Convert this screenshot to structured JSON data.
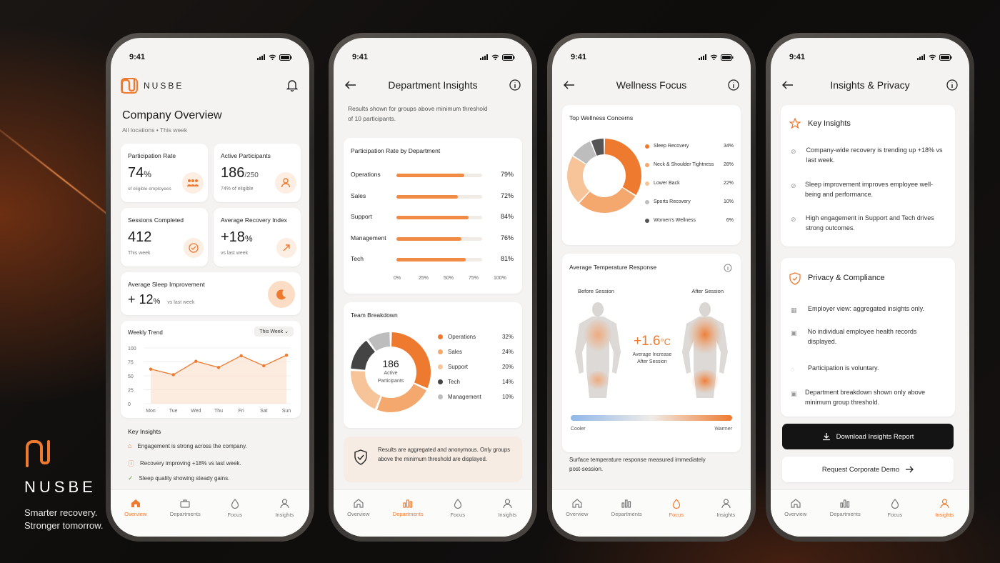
{
  "brand": {
    "name": "NUSBE",
    "tagline1": "Smarter recovery.",
    "tagline2": "Stronger tomorrow."
  },
  "status_time": "9:41",
  "tabs": [
    "Overview",
    "Departments",
    "Focus",
    "Insights"
  ],
  "overview": {
    "logo": "NUSBE",
    "title": "Company Overview",
    "subtitle": "All locations • This week",
    "cards": [
      {
        "label": "Participation Rate",
        "value": "74",
        "unit": "%",
        "sub": "of eligible employees",
        "icon": "people-icon"
      },
      {
        "label": "Active Participants",
        "value": "186",
        "unit": "/250",
        "sub": "74% of eligible",
        "icon": "person-icon"
      },
      {
        "label": "Sessions Completed",
        "value": "412",
        "unit": "",
        "sub": "This week",
        "icon": "check-icon"
      },
      {
        "label": "Average Recovery Index",
        "value": "+18",
        "unit": "%",
        "sub": "vs last week",
        "icon": "trend-icon"
      }
    ],
    "sleep": {
      "label": "Average Sleep Improvement",
      "value": "+ 12",
      "unit": "%",
      "sub": "vs last week"
    },
    "trend": {
      "title": "Weekly Trend",
      "filter": "This Week",
      "yticks": [
        "100",
        "75",
        "50",
        "25",
        "0"
      ],
      "days": [
        "Mon",
        "Tue",
        "Wed",
        "Thu",
        "Fri",
        "Sat",
        "Sun"
      ],
      "values": [
        62,
        52,
        76,
        65,
        86,
        68,
        87
      ]
    },
    "insights_title": "Key Insights",
    "insights": [
      "Engagement is strong across the company.",
      "Recovery improving +18% vs last week.",
      "Sleep quality showing steady gains."
    ]
  },
  "dept": {
    "title": "Department Insights",
    "note": "Results shown for groups above minimum threshold of 10 participants.",
    "bars_title": "Participation Rate by Department",
    "bars": [
      {
        "name": "Operations",
        "value": 79,
        "label": "79%"
      },
      {
        "name": "Sales",
        "value": 72,
        "label": "72%"
      },
      {
        "name": "Support",
        "value": 84,
        "label": "84%"
      },
      {
        "name": "Management",
        "value": 76,
        "label": "76%"
      },
      {
        "name": "Tech",
        "value": 81,
        "label": "81%"
      }
    ],
    "axis": [
      "0%",
      "25%",
      "50%",
      "75%",
      "100%"
    ],
    "team_title": "Team Breakdown",
    "center_value": "186",
    "center_label1": "Active",
    "center_label2": "Participants",
    "team": [
      {
        "name": "Operations",
        "value": 32,
        "label": "32%",
        "color": "#ee7a30"
      },
      {
        "name": "Sales",
        "value": 24,
        "label": "24%",
        "color": "#f4a86e"
      },
      {
        "name": "Support",
        "value": 20,
        "label": "20%",
        "color": "#f7c49a"
      },
      {
        "name": "Tech",
        "value": 14,
        "label": "14%",
        "color": "#444444"
      },
      {
        "name": "Management",
        "value": 10,
        "label": "10%",
        "color": "#bdbdbd"
      }
    ],
    "privacy_note": "Results are aggregated and anonymous. Only groups above the minimum threshold are displayed."
  },
  "focus": {
    "title": "Wellness Focus",
    "concerns_title": "Top Wellness Concerns",
    "concerns": [
      {
        "name": "Sleep Recovery",
        "value": 34,
        "label": "34%",
        "color": "#ee7a30"
      },
      {
        "name": "Neck & Shoulder Tightness",
        "value": 28,
        "label": "28%",
        "color": "#f4a86e"
      },
      {
        "name": "Lower Back",
        "value": 22,
        "label": "22%",
        "color": "#f7c49a"
      },
      {
        "name": "Sports Recovery",
        "value": 10,
        "label": "10%",
        "color": "#bdbdbd"
      },
      {
        "name": "Women's Wellness",
        "value": 6,
        "label": "6%",
        "color": "#555555"
      }
    ],
    "temp_title": "Average Temperature Response",
    "before": "Before Session",
    "after": "After Session",
    "delta": "+1.6",
    "delta_unit": "°C",
    "delta_label1": "Average Increase",
    "delta_label2": "After Session",
    "cooler": "Cooler",
    "warmer": "Warmer",
    "note": "Surface temperature response measured immediately post-session."
  },
  "privacy": {
    "title": "Insights & Privacy",
    "key_title": "Key Insights",
    "key": [
      "Company-wide recovery is trending up +18% vs last week.",
      "Sleep improvement improves employee well-being and performance.",
      "High engagement in Support and Tech drives strong outcomes."
    ],
    "comp_title": "Privacy & Compliance",
    "comp": [
      "Employer view: aggregated insights only.",
      "No individual employee health records displayed.",
      "Participation is voluntary.",
      "Department breakdown shown only above minimum group threshold."
    ],
    "download": "Download Insights Report",
    "demo": "Request Corporate Demo"
  },
  "colors": {
    "accent": "#ee7a30",
    "light": "#f4a86e",
    "pale": "#f7c49a"
  }
}
